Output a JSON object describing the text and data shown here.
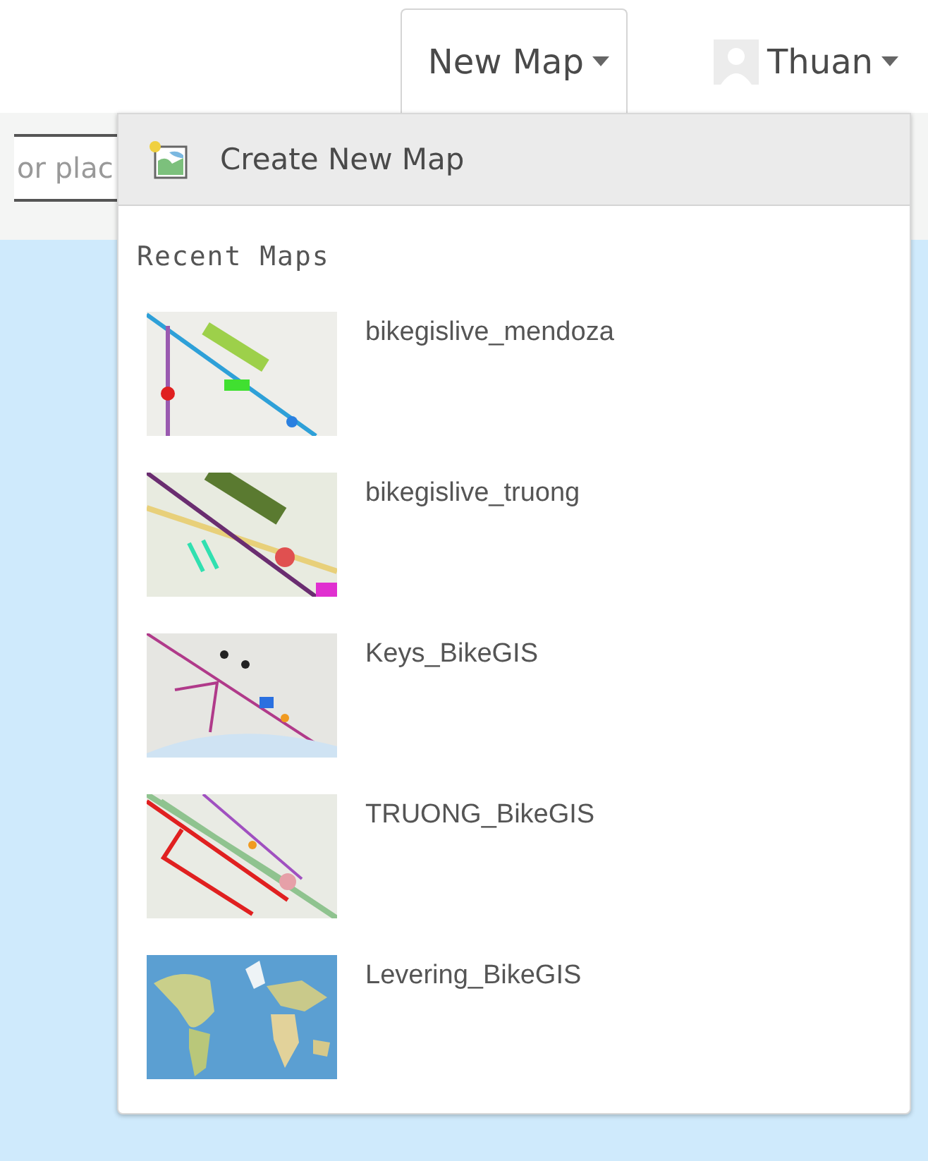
{
  "nav": [
    {
      "label": "New Map",
      "kind": "menu",
      "selected": true
    },
    {
      "label": "Thuan",
      "kind": "user",
      "selected": false
    }
  ],
  "search": {
    "placeholder": "or plac"
  },
  "menu": {
    "create_label": "Create New Map",
    "section_title": "Recent Maps",
    "recent_maps": [
      {
        "name": "bikegislive_mendoza"
      },
      {
        "name": "bikegislive_truong"
      },
      {
        "name": "Keys_BikeGIS"
      },
      {
        "name": "TRUONG_BikeGIS"
      },
      {
        "name": "Levering_BikeGIS"
      }
    ]
  }
}
